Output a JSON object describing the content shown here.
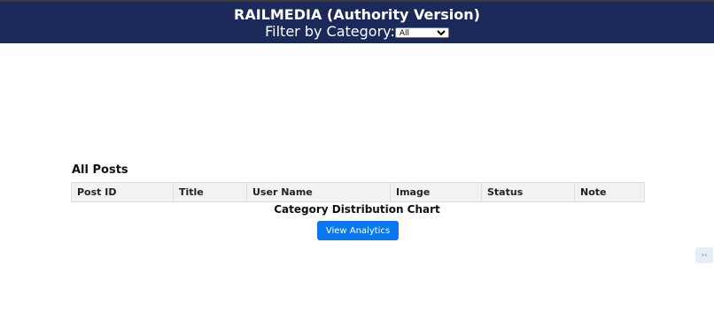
{
  "header": {
    "title": "RAILMEDIA (Authority Version)",
    "filter_label": "Filter by Category:",
    "category_select": {
      "selected": "All",
      "options": [
        "All"
      ]
    }
  },
  "posts_section": {
    "title": "All Posts",
    "columns": [
      "Post ID",
      "Title",
      "User Name",
      "Image",
      "Status",
      "Note"
    ],
    "rows": []
  },
  "chart_section": {
    "title": "Category Distribution Chart",
    "button_label": "View Analytics"
  },
  "side_widget": {
    "glyph": "›‹"
  },
  "colors": {
    "header_bg": "#1b2a5a",
    "button_bg": "#0a79f0"
  }
}
